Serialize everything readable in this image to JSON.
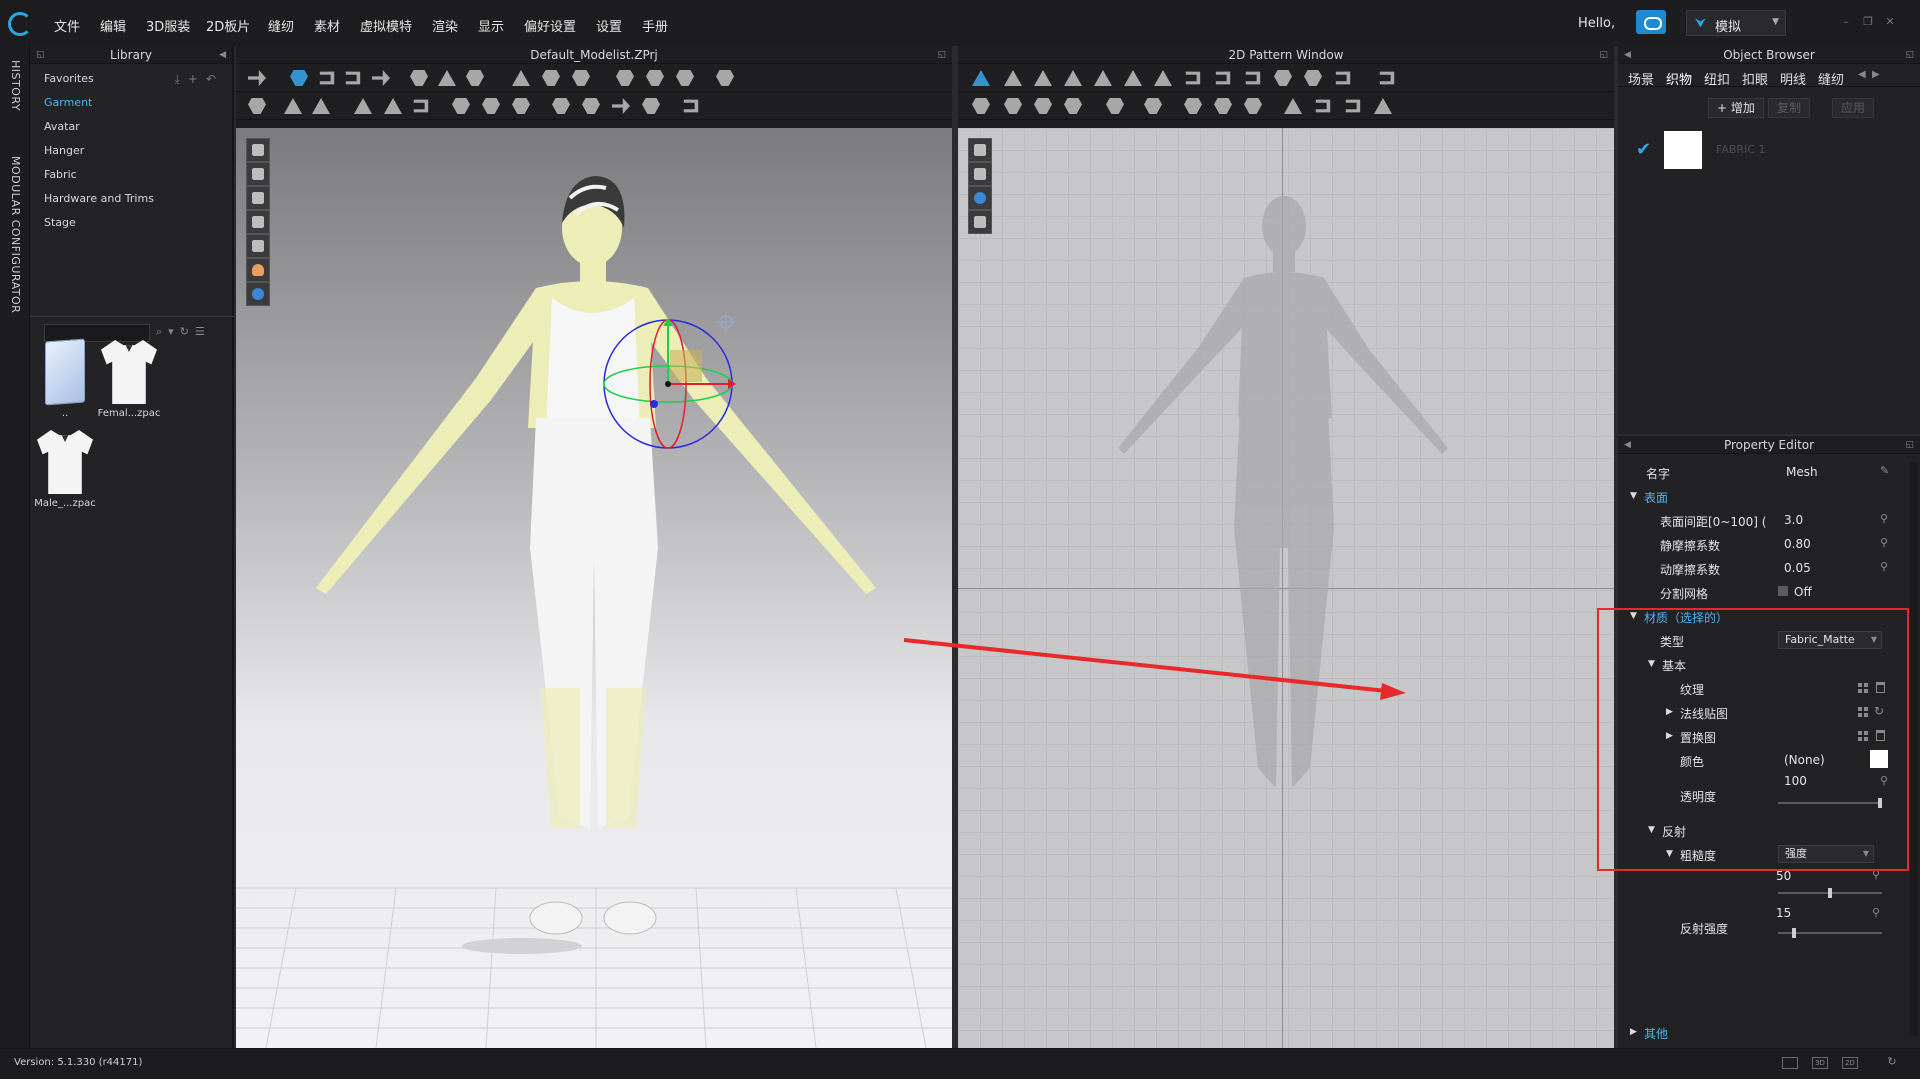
{
  "menubar": {
    "items": [
      "文件",
      "编辑",
      "3D服装",
      "2D板片",
      "缝纫",
      "素材",
      "虚拟模特",
      "渲染",
      "显示",
      "偏好设置",
      "设置",
      "手册"
    ],
    "greeting": "Hello,",
    "mode": "模拟",
    "accent_color": "#28a8e0"
  },
  "left_strip": {
    "history": "HISTORY",
    "modular": "MODULAR CONFIGURATOR"
  },
  "library": {
    "title": "Library",
    "nav": [
      "Favorites",
      "Garment",
      "Avatar",
      "Hanger",
      "Fabric",
      "Hardware and Trims",
      "Stage"
    ],
    "active_nav": "Garment",
    "files": [
      {
        "name": "..",
        "icon": "folder-icon"
      },
      {
        "name": "Femal...zpac",
        "icon": "tshirt-icon"
      },
      {
        "name": "Male_...zpac",
        "icon": "tshirt-icon"
      }
    ]
  },
  "window3d": {
    "title": "Default_Modelist.ZPrj"
  },
  "window2d": {
    "title": "2D Pattern Window"
  },
  "object_browser": {
    "title": "Object Browser",
    "tabs": [
      "场景",
      "织物",
      "纽扣",
      "扣眼",
      "明线",
      "缝纫"
    ],
    "active_tab": "织物",
    "actions": {
      "add": "+ 增加",
      "copy": "复制",
      "apply": "应用"
    },
    "fabric": {
      "name": "FABRIC 1",
      "color": "#ffffff",
      "checked": true
    }
  },
  "property_editor": {
    "title": "Property Editor",
    "name_label": "名字",
    "name_value": "Mesh",
    "surface": {
      "header": "表面",
      "thickness_label": "表面间距[0~100] (",
      "thickness_value": "3.0",
      "static_friction_label": "静摩擦系数",
      "static_friction_value": "0.80",
      "dynamic_friction_label": "动摩擦系数",
      "dynamic_friction_value": "0.05",
      "split_mesh_label": "分割网格",
      "split_mesh_value": "Off"
    },
    "material": {
      "header": "材质（选择的）",
      "type_label": "类型",
      "type_value": "Fabric_Matte",
      "basic_header": "基本",
      "texture_label": "纹理",
      "normal_map_label": "法线贴图",
      "displacement_label": "置换图",
      "color_label": "颜色",
      "color_value": "(None)",
      "opacity_label": "透明度",
      "opacity_value": "100",
      "opacity_fraction": 1.0
    },
    "reflection": {
      "header": "反射",
      "roughness_label": "粗糙度",
      "roughness_mode": "强度",
      "roughness_value": "50",
      "roughness_fraction": 0.5,
      "reflect_strength_label": "反射强度",
      "reflect_strength_value": "15",
      "reflect_strength_fraction": 0.15
    },
    "other_header": "其他"
  },
  "status": {
    "version": "Version: 5.1.330 (r44171)"
  },
  "annotation_color": "#e8282b"
}
